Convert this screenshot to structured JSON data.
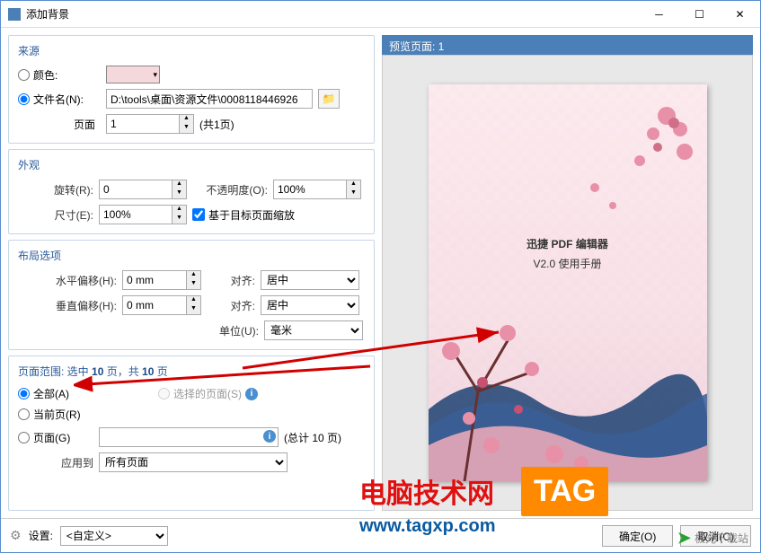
{
  "window": {
    "title": "添加背景"
  },
  "source": {
    "title": "来源",
    "color_label": "颜色:",
    "file_label": "文件名(N):",
    "file_value": "D:\\tools\\桌面\\资源文件\\0008118446926",
    "page_label": "页面",
    "page_value": "1",
    "page_total": "(共1页)"
  },
  "appearance": {
    "title": "外观",
    "rotate_label": "旋转(R):",
    "rotate_value": "0",
    "opacity_label": "不透明度(O):",
    "opacity_value": "100%",
    "size_label": "尺寸(E):",
    "size_value": "100%",
    "scale_cb": "基于目标页面缩放"
  },
  "layout": {
    "title": "布局选项",
    "hoff_label": "水平偏移(H):",
    "hoff_value": "0 mm",
    "align_label": "对齐:",
    "align_h": "居中",
    "voff_label": "垂直偏移(H):",
    "voff_value": "0 mm",
    "align_v": "居中",
    "unit_label": "单位(U):",
    "unit_value": "毫米"
  },
  "range": {
    "title_prefix": "页面范围: 选中 ",
    "title_mid": " 页，共 ",
    "title_suffix": " 页",
    "count1": "10",
    "count2": "10",
    "all": "全部(A)",
    "selected": "选择的页面(S)",
    "current": "当前页(R)",
    "pages": "页面(G)",
    "total": "(总计 10 页)",
    "apply_label": "应用到",
    "apply_value": "所有页面"
  },
  "preview": {
    "label": "预览页面: 1",
    "doc_line1": "迅捷 PDF 编辑器",
    "doc_line2": "V2.0 使用手册"
  },
  "footer": {
    "settings_label": "设置:",
    "settings_value": "<自定义>",
    "ok": "确定(O)",
    "cancel": "取消(C)"
  },
  "watermark": {
    "w1": "电脑技术网",
    "w2": "www.tagxp.com",
    "tag": "TAG",
    "w3": "极光下载站"
  }
}
